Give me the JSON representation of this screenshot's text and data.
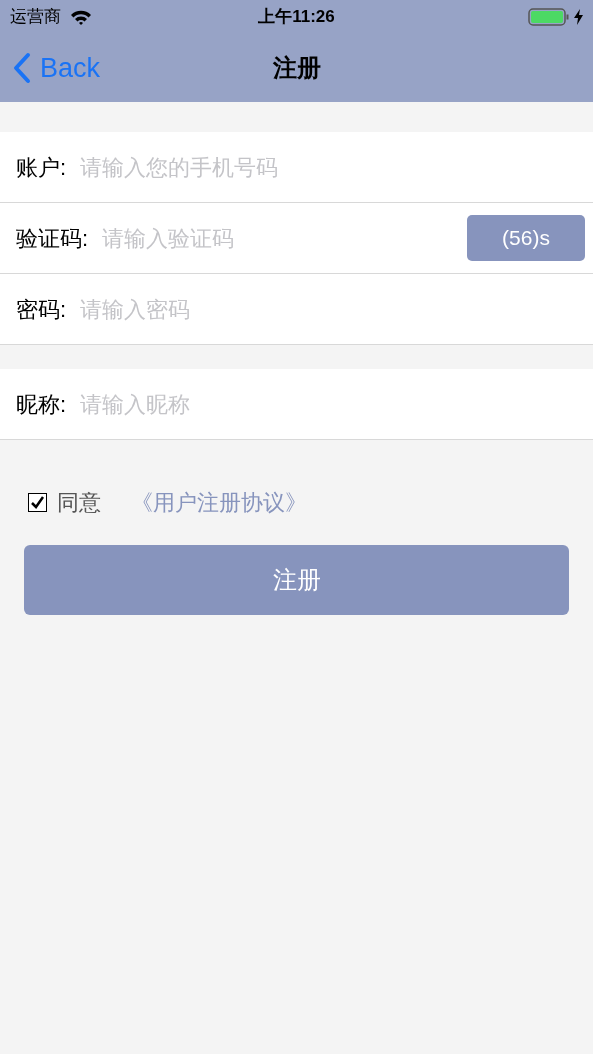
{
  "status_bar": {
    "carrier": "运营商",
    "time": "上午11:26"
  },
  "nav": {
    "back": "Back",
    "title": "注册"
  },
  "form_groups": [
    {
      "rows": [
        {
          "label": "账户:",
          "placeholder": "请输入您的手机号码"
        },
        {
          "label": "验证码:",
          "placeholder": "请输入验证码",
          "button": "(56)s"
        },
        {
          "label": "密码:",
          "placeholder": "请输入密码"
        }
      ]
    },
    {
      "rows": [
        {
          "label": "昵称:",
          "placeholder": "请输入昵称"
        }
      ]
    }
  ],
  "agreement": {
    "checked": true,
    "label": "同意",
    "link": "《用户注册协议》"
  },
  "submit": "注册"
}
